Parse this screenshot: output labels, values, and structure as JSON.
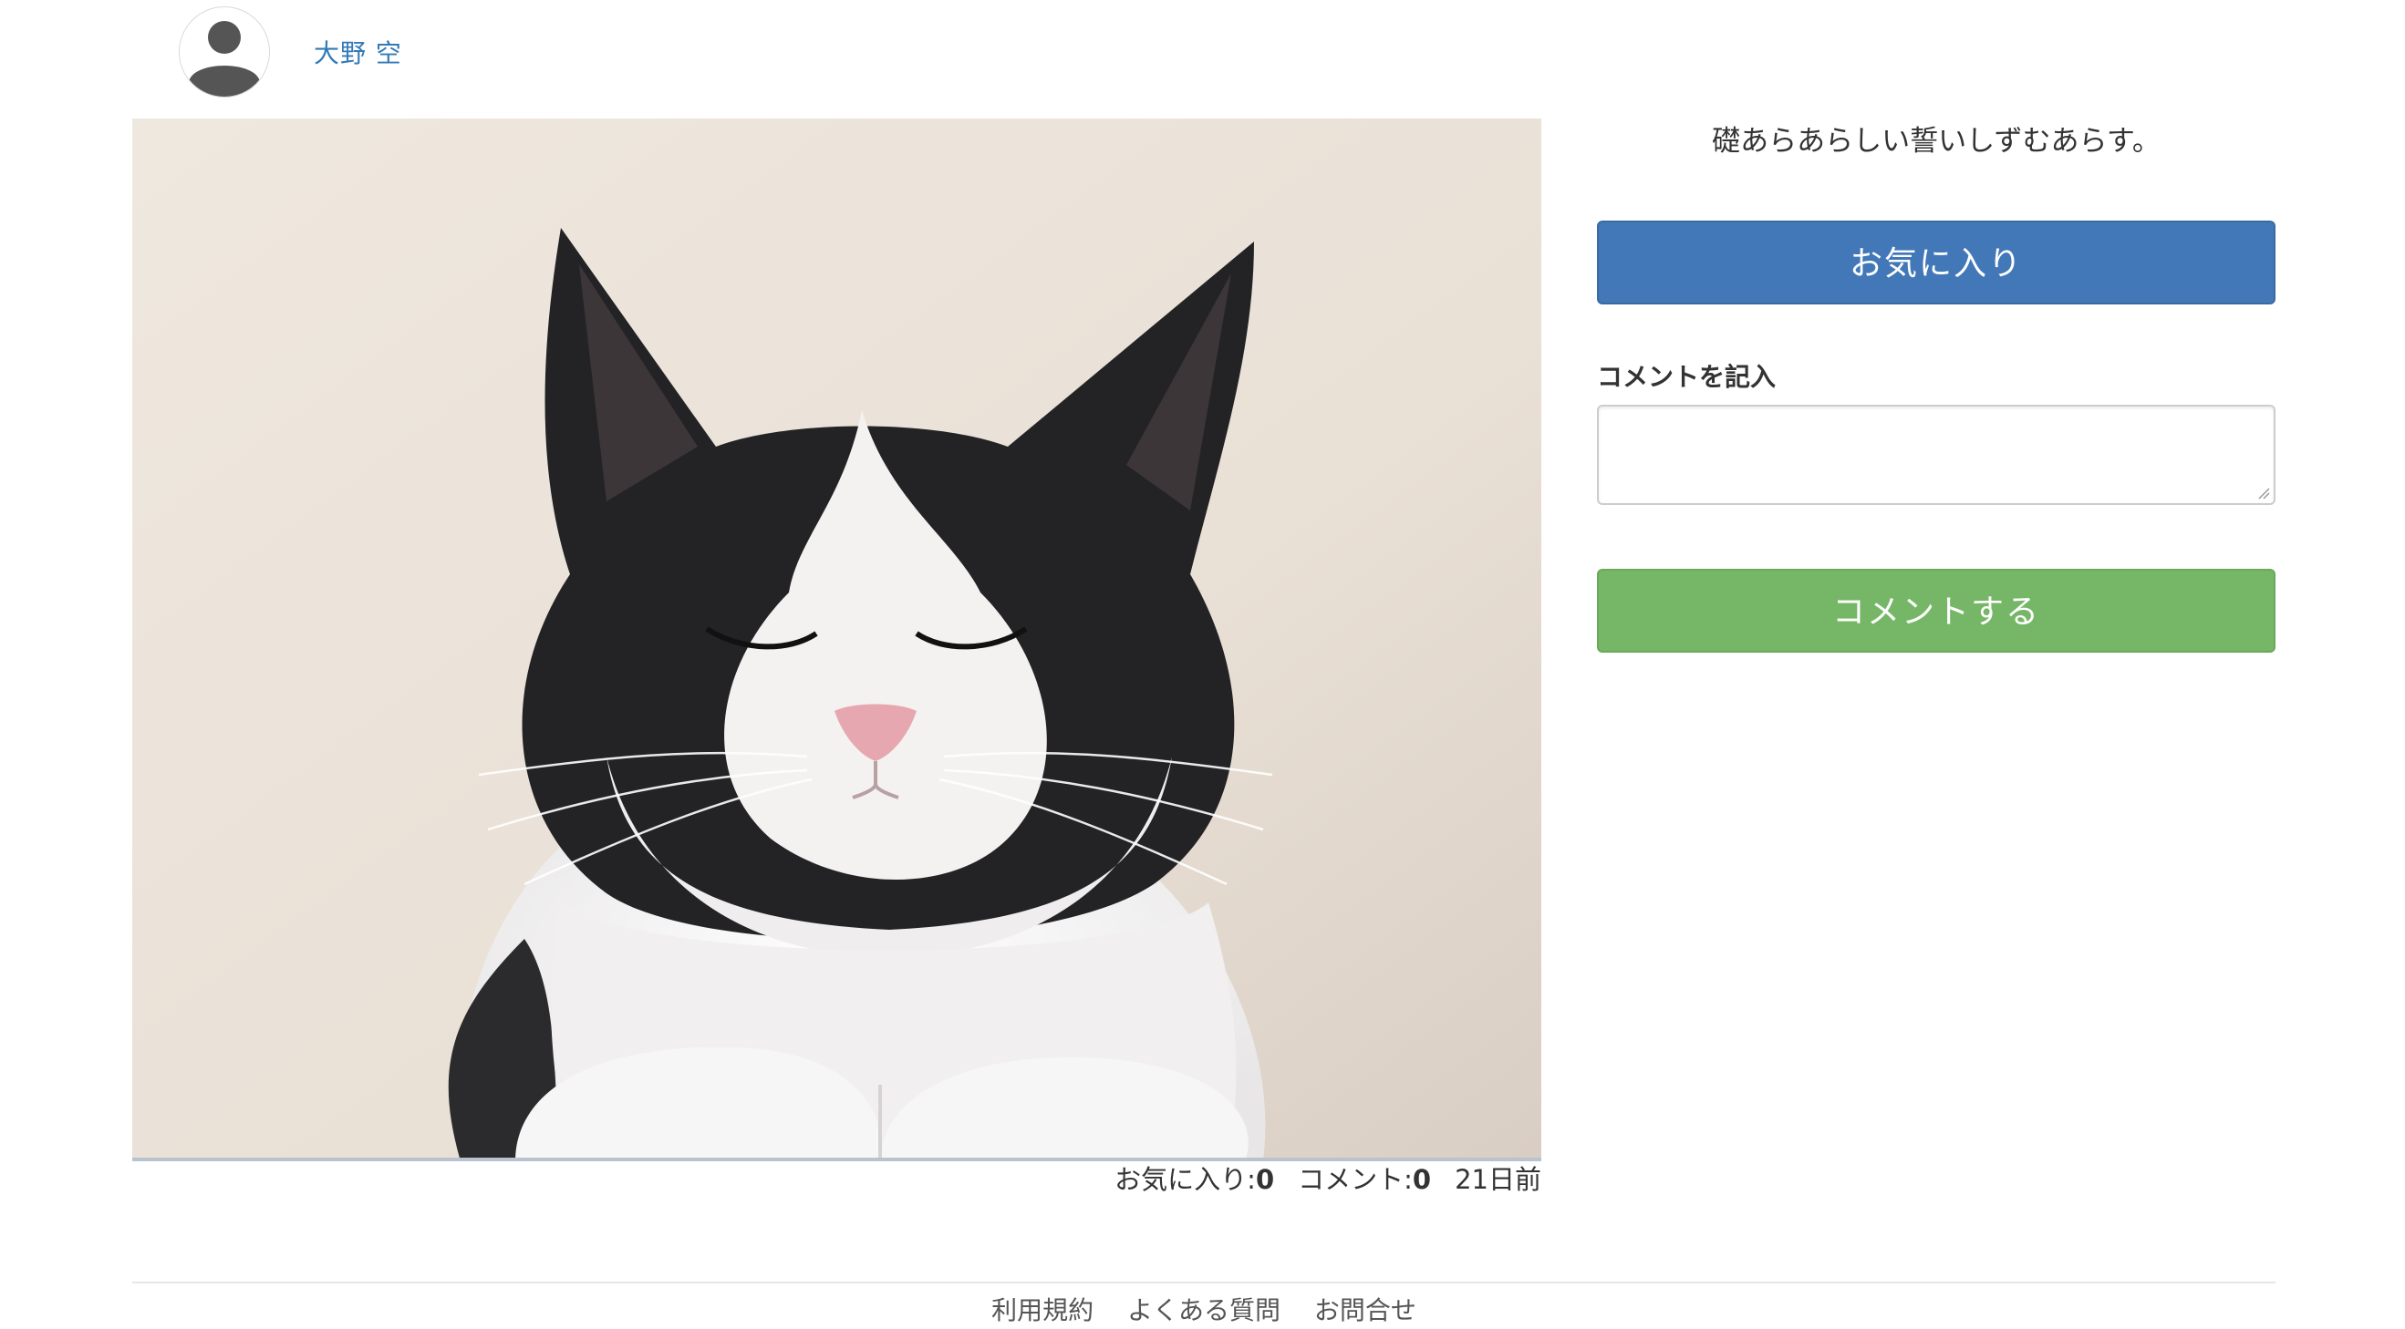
{
  "user": {
    "name": "大野 空",
    "avatar_icon": "user-silhouette-icon"
  },
  "post": {
    "image_alt": "black-and-white cat photo",
    "caption": "礎あらあらしい誓いしずむあらす。",
    "meta": {
      "favorites_label": "お気に入り:",
      "favorites_count": "0",
      "comments_label": "コメント:",
      "comments_count": "0",
      "posted_ago": "21日前"
    }
  },
  "actions": {
    "favorite_label": "お気に入り",
    "favorite_color": "#4278b8",
    "comment_field_label": "コメントを記入",
    "comment_value": "",
    "comment_submit_label": "コメントする",
    "comment_submit_color": "#75b766"
  },
  "footer": {
    "links": [
      {
        "label": "利用規約"
      },
      {
        "label": "よくある質問"
      },
      {
        "label": "お問合せ"
      }
    ]
  },
  "colors": {
    "link": "#337ab7"
  }
}
